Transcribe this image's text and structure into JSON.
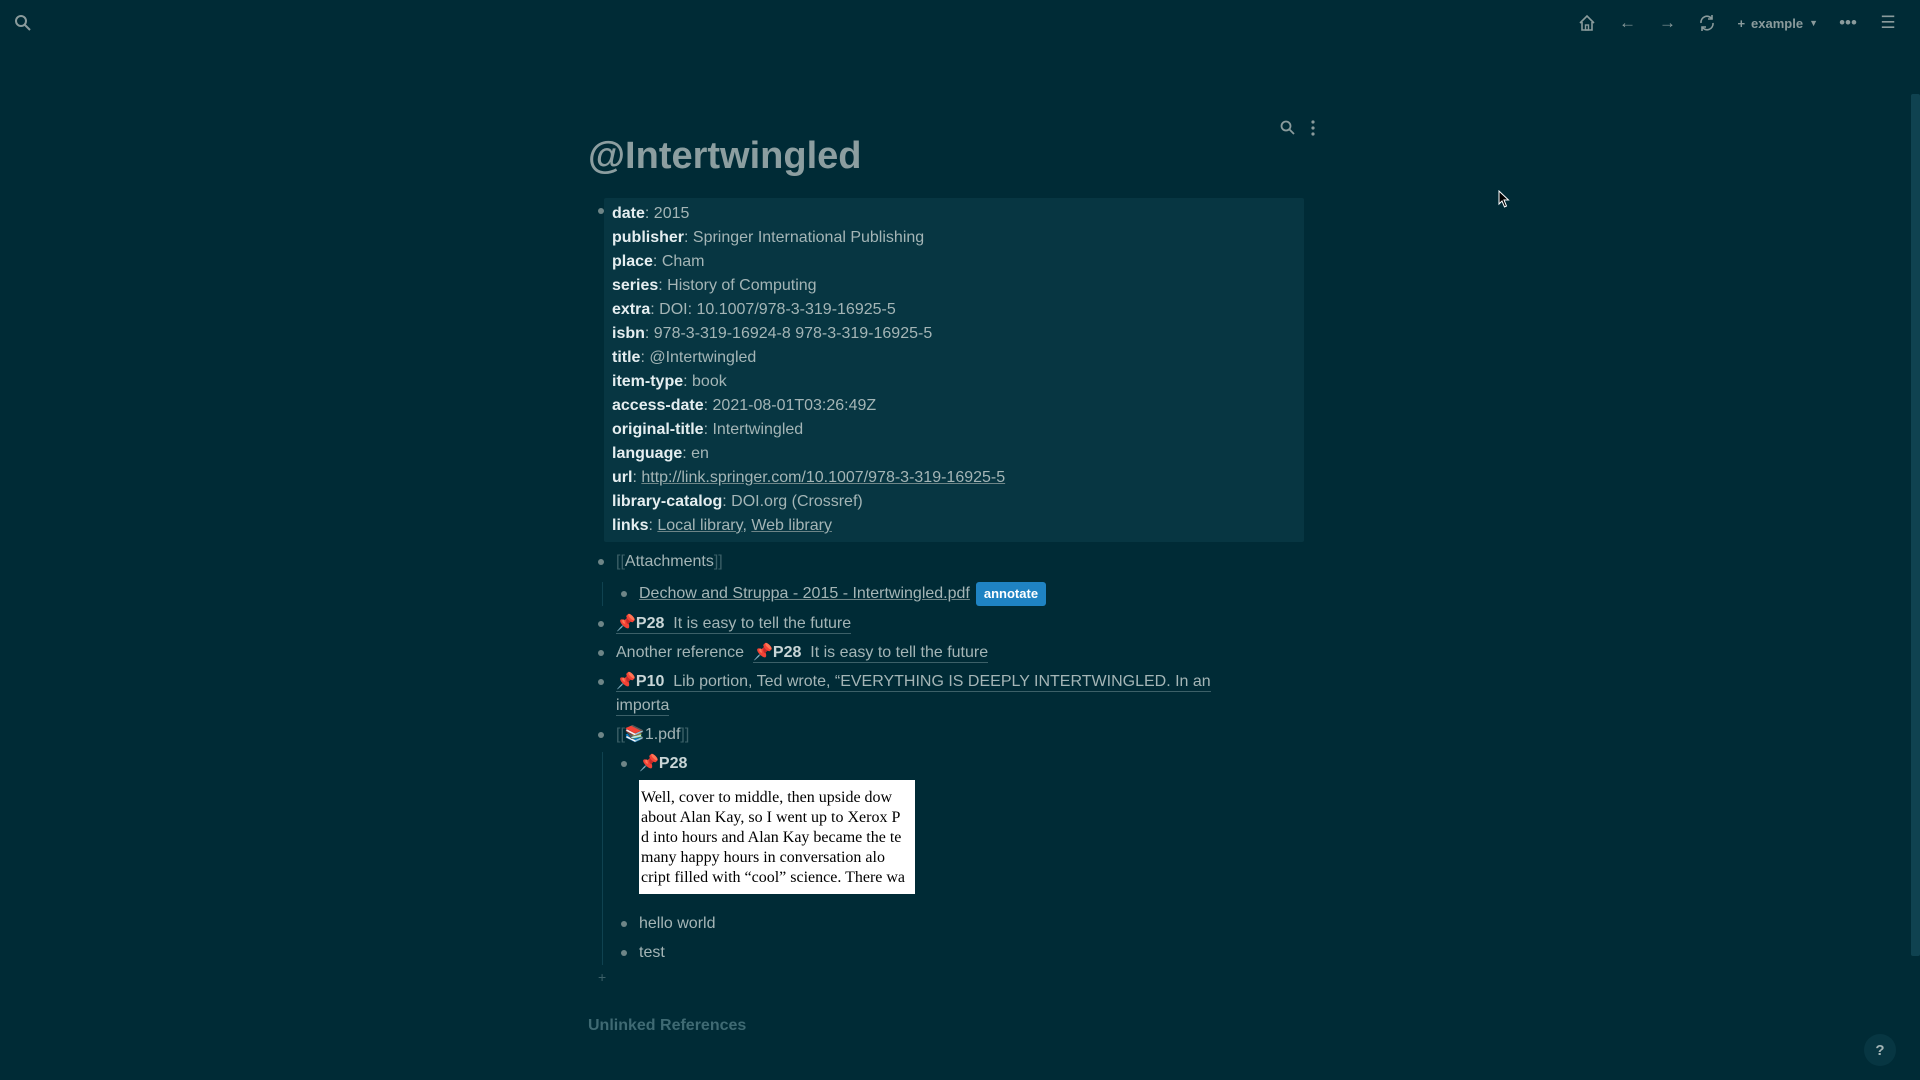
{
  "topbar": {
    "search_icon": "search-icon",
    "graph_name": "example",
    "icons": [
      "home-icon",
      "back-arrow-icon",
      "forward-arrow-icon",
      "refresh-icon",
      "more-icon",
      "menu-icon"
    ]
  },
  "page": {
    "title": "@Intertwingled",
    "properties": [
      {
        "key": "date",
        "value": "2015"
      },
      {
        "key": "publisher",
        "value": "Springer International Publishing"
      },
      {
        "key": "place",
        "value": "Cham"
      },
      {
        "key": "series",
        "value": "History of Computing"
      },
      {
        "key": "extra",
        "value": "DOI: 10.1007/978-3-319-16925-5"
      },
      {
        "key": "isbn",
        "value": "978-3-319-16924-8 978-3-319-16925-5"
      },
      {
        "key": "title",
        "value": "@Intertwingled"
      },
      {
        "key": "item-type",
        "value": "book"
      },
      {
        "key": "access-date",
        "value": "2021-08-01T03:26:49Z"
      },
      {
        "key": "original-title",
        "value": "Intertwingled"
      },
      {
        "key": "language",
        "value": "en"
      }
    ],
    "url_key": "url",
    "url_value": "http://link.springer.com/10.1007/978-3-319-16925-5",
    "catalog_key": "library-catalog",
    "catalog_value": "DOI.org (Crossref)",
    "links_key": "links",
    "links": [
      "Local library",
      "Web library"
    ],
    "attachments_label": "Attachments",
    "attachment_file": "Dechow and Struppa - 2015 - Intertwingled.pdf",
    "annotate_label": "annotate",
    "ref1_page": "P28",
    "ref1_text": "It is easy to tell the future",
    "ref2_prefix": "Another reference",
    "ref2_page": "P28",
    "ref2_text": "It is easy to tell the future",
    "ref3_page": "P10",
    "ref3_text": "Lib  portion,  Ted wrote,  “EVERYTHING  IS  DEEPLY  INTERTWINGLED.  In  an",
    "ref3_text2": "importa",
    "pdf_link": "1.pdf",
    "pdf_emoji": "📚",
    "sub_page": "P28",
    "quote_lines": [
      "Well, cover to middle, then upside dow",
      "about Alan Kay, so I went up to Xerox P",
      "d into hours and Alan Kay became the te",
      "many happy hours in conversation alo",
      "cript filled with “cool” science. There wa"
    ],
    "child1": "hello world",
    "child2": "test",
    "unlinked_label": "Unlinked References",
    "help_label": "?"
  },
  "colors": {
    "background": "#002b36",
    "block_bg": "#073642",
    "accent": "#1f83c3",
    "pin": "#d9534f"
  }
}
